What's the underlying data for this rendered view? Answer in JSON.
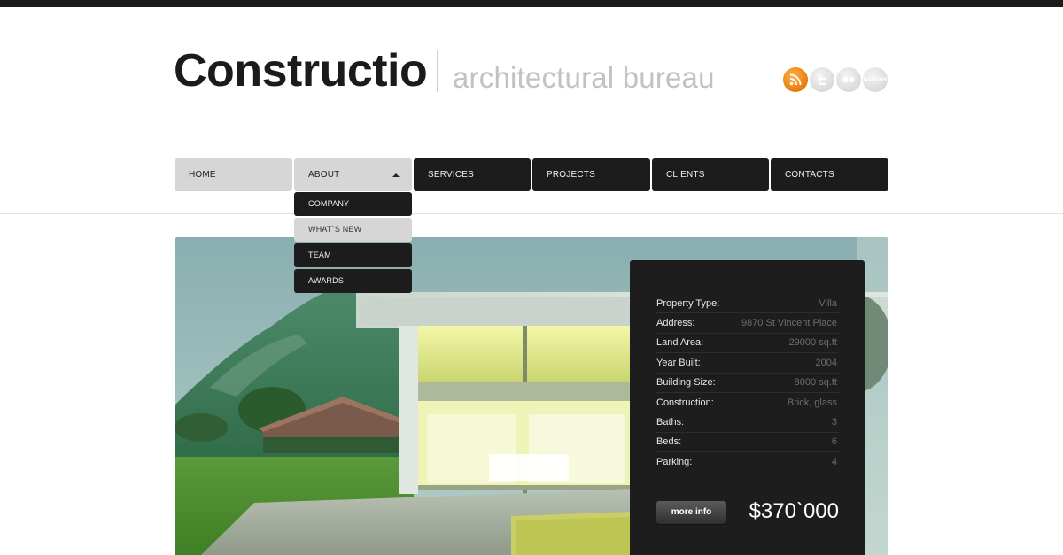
{
  "header": {
    "logo": "Constructio",
    "tagline": "architectural bureau",
    "social": [
      {
        "name": "rss-icon"
      },
      {
        "name": "twitter-icon"
      },
      {
        "name": "flickr-icon"
      },
      {
        "name": "facebook-icon",
        "label": "facebook"
      }
    ]
  },
  "nav": {
    "items": [
      {
        "label": "HOME",
        "active": true
      },
      {
        "label": "ABOUT",
        "active": true,
        "open": true
      },
      {
        "label": "SERVICES"
      },
      {
        "label": "PROJECTS"
      },
      {
        "label": "CLIENTS"
      },
      {
        "label": "CONTACTS"
      }
    ],
    "about_dropdown": [
      {
        "label": "COMPANY"
      },
      {
        "label": "WHAT`S NEW",
        "hover": true
      },
      {
        "label": "TEAM"
      },
      {
        "label": "AWARDS"
      }
    ]
  },
  "property": {
    "specs": [
      {
        "label": "Property Type:",
        "value": "Villa"
      },
      {
        "label": "Address:",
        "value": "9870 St Vincent Place"
      },
      {
        "label": "Land Area:",
        "value": "29000 sq.ft"
      },
      {
        "label": "Year Built:",
        "value": "2004"
      },
      {
        "label": "Building Size:",
        "value": "8000 sq.ft"
      },
      {
        "label": "Construction:",
        "value": "Brick, glass"
      },
      {
        "label": "Baths:",
        "value": "3"
      },
      {
        "label": "Beds:",
        "value": "6"
      },
      {
        "label": "Parking:",
        "value": "4"
      }
    ],
    "more_info_label": "more info",
    "price": "$370`000"
  },
  "colors": {
    "accent_rss": "#e77a0d",
    "nav_dark": "#1c1c1c",
    "nav_light": "#d6d6d6",
    "panel": "#1d1d1d"
  }
}
